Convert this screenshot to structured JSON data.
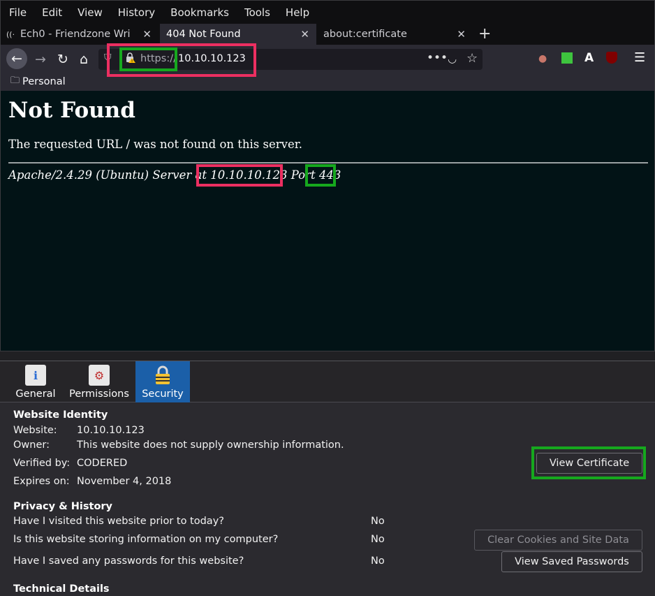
{
  "menubar": [
    "File",
    "Edit",
    "View",
    "History",
    "Bookmarks",
    "Tools",
    "Help"
  ],
  "tabs": [
    {
      "title": "Ech0 - Friendzone Wri",
      "close": "✕"
    },
    {
      "title": "404 Not Found",
      "close": "✕"
    },
    {
      "title": "about:certificate",
      "close": "✕"
    }
  ],
  "newtab_glyph": "+",
  "urlbar": {
    "protocol": "https://",
    "host": "10.10.10.123"
  },
  "bookmarks": {
    "folder": "Personal"
  },
  "page": {
    "heading": "Not Found",
    "message": "The requested URL / was not found on this server.",
    "address_prefix": "Apache/2.4.29 (Ubuntu) Server at",
    "address_host": "10.10.10.123",
    "address_port_label": "Port",
    "address_port": "443"
  },
  "pageinfo": {
    "tabs": [
      "General",
      "Permissions",
      "Security"
    ],
    "identity": {
      "header": "Website Identity",
      "website_label": "Website:",
      "website_value": "10.10.10.123",
      "owner_label": "Owner:",
      "owner_value": "This website does not supply ownership information.",
      "verified_label": "Verified by:",
      "verified_value": "CODERED",
      "expires_label": "Expires on:",
      "expires_value": "November 4, 2018",
      "view_cert": "View Certificate"
    },
    "privacy": {
      "header": "Privacy & History",
      "q1": "Have I visited this website prior to today?",
      "a1": "No",
      "q2": "Is this website storing information on my computer?",
      "a2": "No",
      "clear_btn": "Clear Cookies and Site Data",
      "q3": "Have I saved any passwords for this website?",
      "a3": "No",
      "passwords_btn": "View Saved Passwords"
    },
    "technical": {
      "header": "Technical Details"
    }
  },
  "colors": {
    "highlight_red": "#ec2f61",
    "highlight_green": "#16a81e",
    "content_bg": "#021316",
    "selected_tab": "#1b5fa8"
  }
}
